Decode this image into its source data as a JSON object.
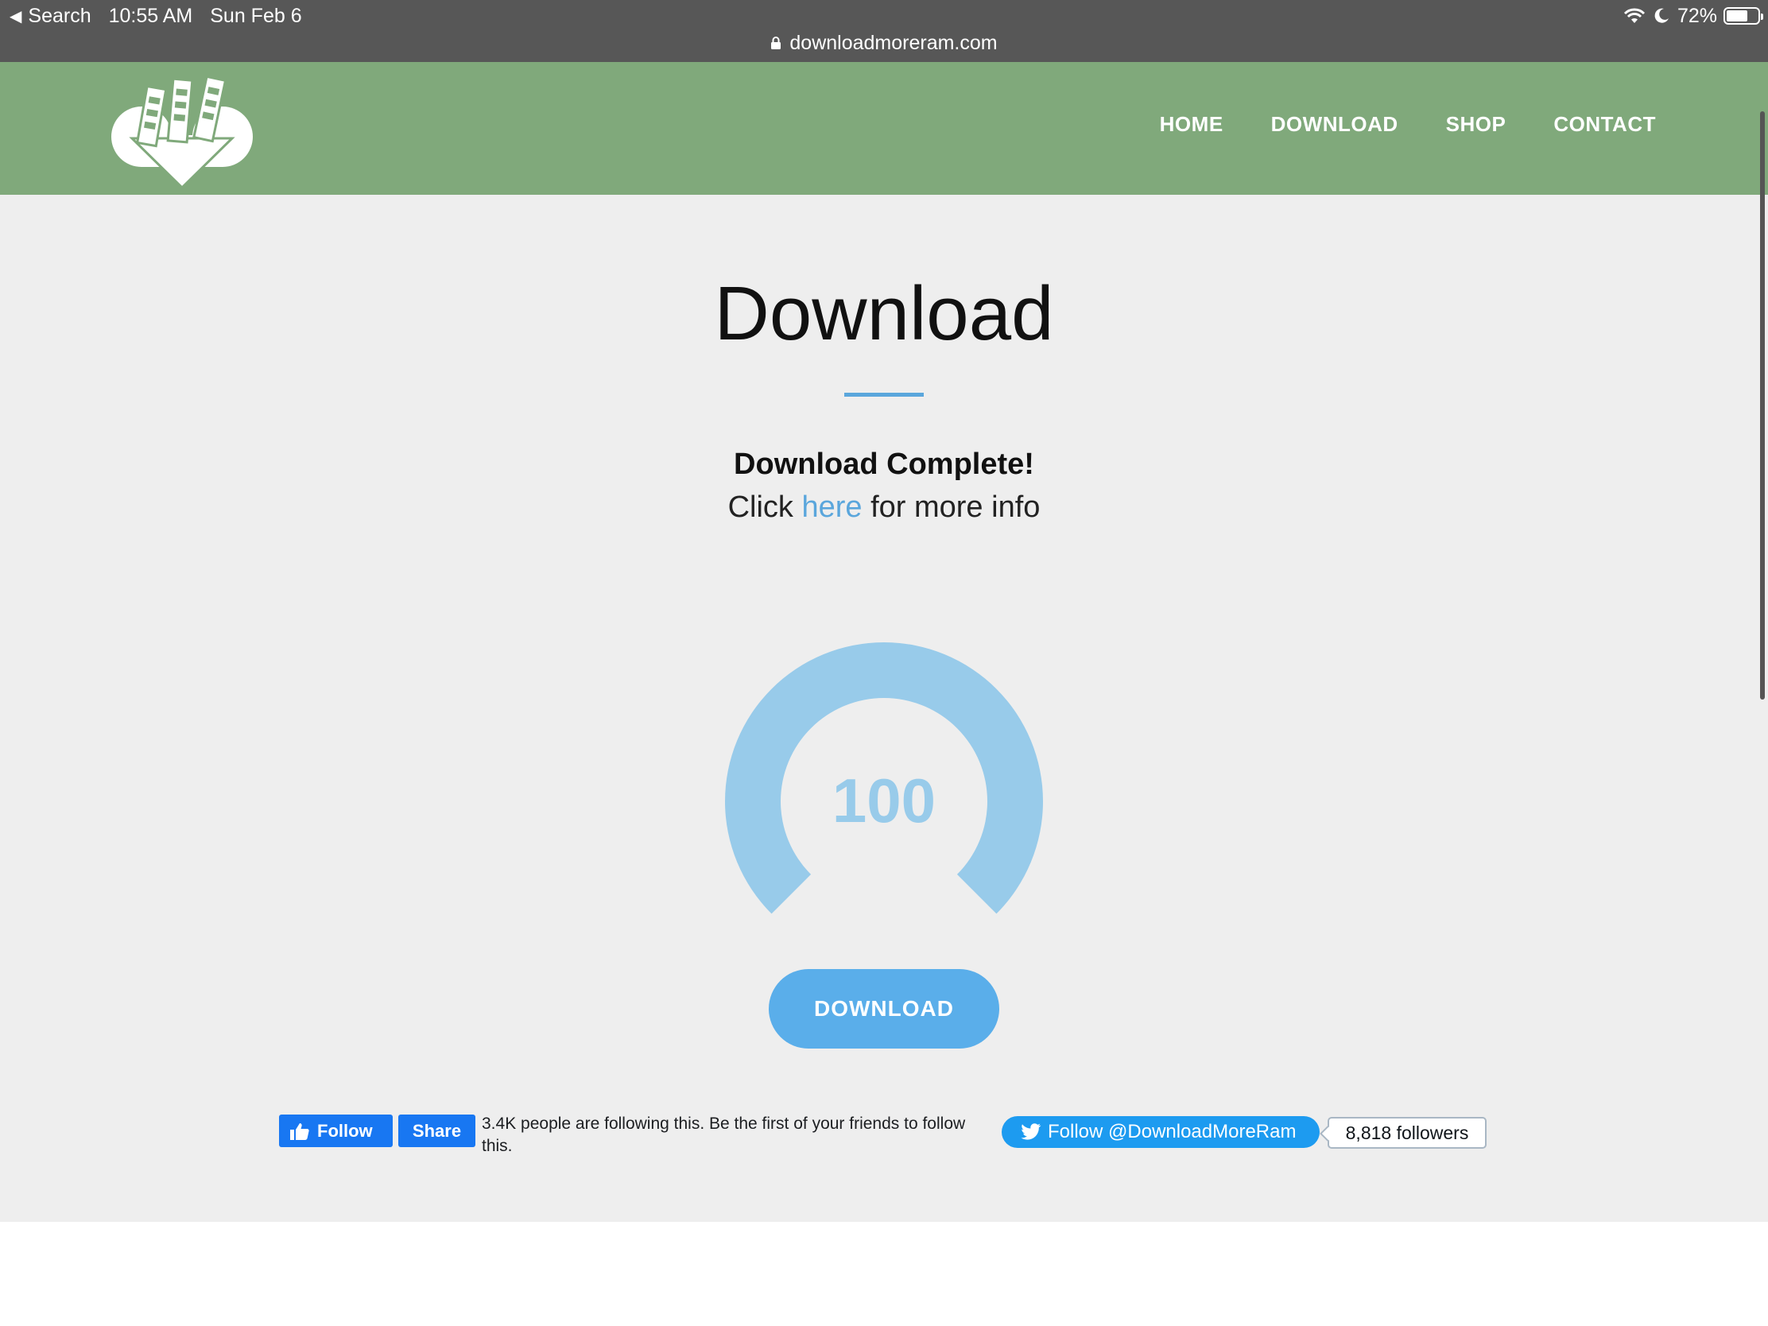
{
  "status_bar": {
    "back_label": "Search",
    "time": "10:55 AM",
    "date": "Sun Feb 6",
    "battery": "72%",
    "battery_level": 0.72,
    "url": "downloadmoreram.com"
  },
  "nav": {
    "items": [
      {
        "label": "HOME"
      },
      {
        "label": "DOWNLOAD"
      },
      {
        "label": "SHOP"
      },
      {
        "label": "CONTACT"
      }
    ]
  },
  "main": {
    "title": "Download",
    "complete_text": "Download Complete!",
    "info_prefix": "Click ",
    "info_link": "here",
    "info_suffix": " for more info",
    "gauge_value": "100",
    "gauge_percent": 100,
    "download_button": "DOWNLOAD"
  },
  "social": {
    "fb_follow": "Follow",
    "fb_share": "Share",
    "fb_text": "3.4K people are following this. Be the first of your friends to follow this.",
    "tw_follow": "Follow @DownloadMoreRam",
    "tw_followers": "8,818 followers"
  },
  "colors": {
    "header_green": "#80a97b",
    "accent_blue": "#5aa6dc",
    "gauge_blue": "#98cbea",
    "facebook_blue": "#1877f2",
    "twitter_blue": "#1d9bf0"
  }
}
